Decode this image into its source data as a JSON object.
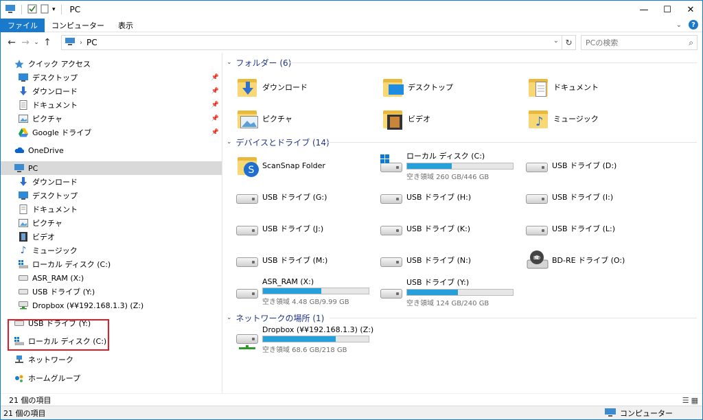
{
  "window": {
    "title": "PC",
    "controls": {
      "minimize": "—",
      "maximize": "☐",
      "close": "✕"
    }
  },
  "ribbon": {
    "tabs": [
      "ファイル",
      "コンピューター",
      "表示"
    ]
  },
  "address": {
    "path_root": "PC",
    "search_placeholder": "PCの検索"
  },
  "sidebar": {
    "quick_access": "クイック アクセス",
    "quick_items": [
      "デスクトップ",
      "ダウンロード",
      "ドキュメント",
      "ピクチャ",
      "Google ドライブ"
    ],
    "onedrive": "OneDrive",
    "pc": "PC",
    "pc_items": [
      "ダウンロード",
      "デスクトップ",
      "ドキュメント",
      "ピクチャ",
      "ビデオ",
      "ミュージック",
      "ローカル ディスク (C:)",
      "ASR_RAM (X:)",
      "USB ドライブ (Y:)",
      "Dropbox (¥¥192.168.1.3) (Z:)"
    ],
    "extra_items": [
      "USB ドライブ (Y:)",
      "ローカル ディスク (C:)"
    ],
    "network": "ネットワーク",
    "homegroup": "ホームグループ"
  },
  "groups": {
    "folders": "フォルダー (6)",
    "devices": "デバイスとドライブ (14)",
    "network": "ネットワークの場所 (1)"
  },
  "folders": [
    "ダウンロード",
    "デスクトップ",
    "ドキュメント",
    "ピクチャ",
    "ビデオ",
    "ミュージック"
  ],
  "drives": [
    {
      "name": "ScanSnap Folder"
    },
    {
      "name": "ローカル ディスク (C:)",
      "free": "空き領域 260 GB/446 GB",
      "used_fraction": 0.42
    },
    {
      "name": "USB ドライブ (D:)"
    },
    {
      "name": "USB ドライブ (G:)"
    },
    {
      "name": "USB ドライブ (H:)"
    },
    {
      "name": "USB ドライブ (I:)"
    },
    {
      "name": "USB ドライブ (J:)"
    },
    {
      "name": "USB ドライブ (K:)"
    },
    {
      "name": "USB ドライブ (L:)"
    },
    {
      "name": "USB ドライブ (M:)"
    },
    {
      "name": "USB ドライブ (N:)"
    },
    {
      "name": "BD-RE ドライブ (O:)"
    },
    {
      "name": "ASR_RAM (X:)",
      "free": "空き領域 4.48 GB/9.99 GB",
      "used_fraction": 0.55
    },
    {
      "name": "USB ドライブ (Y:)",
      "free": "空き領域 124 GB/240 GB",
      "used_fraction": 0.48
    }
  ],
  "network_locations": [
    {
      "name": "Dropbox (¥¥192.168.1.3) (Z:)",
      "free": "空き領域 68.6 GB/218 GB",
      "used_fraction": 0.69
    }
  ],
  "status": {
    "count": "21 個の項目",
    "count2": "21 個の項目",
    "computer": "コンピューター"
  },
  "colors": {
    "accent": "#1979ca",
    "bar": "#26a0da",
    "highlight_box": "#e21b25"
  }
}
